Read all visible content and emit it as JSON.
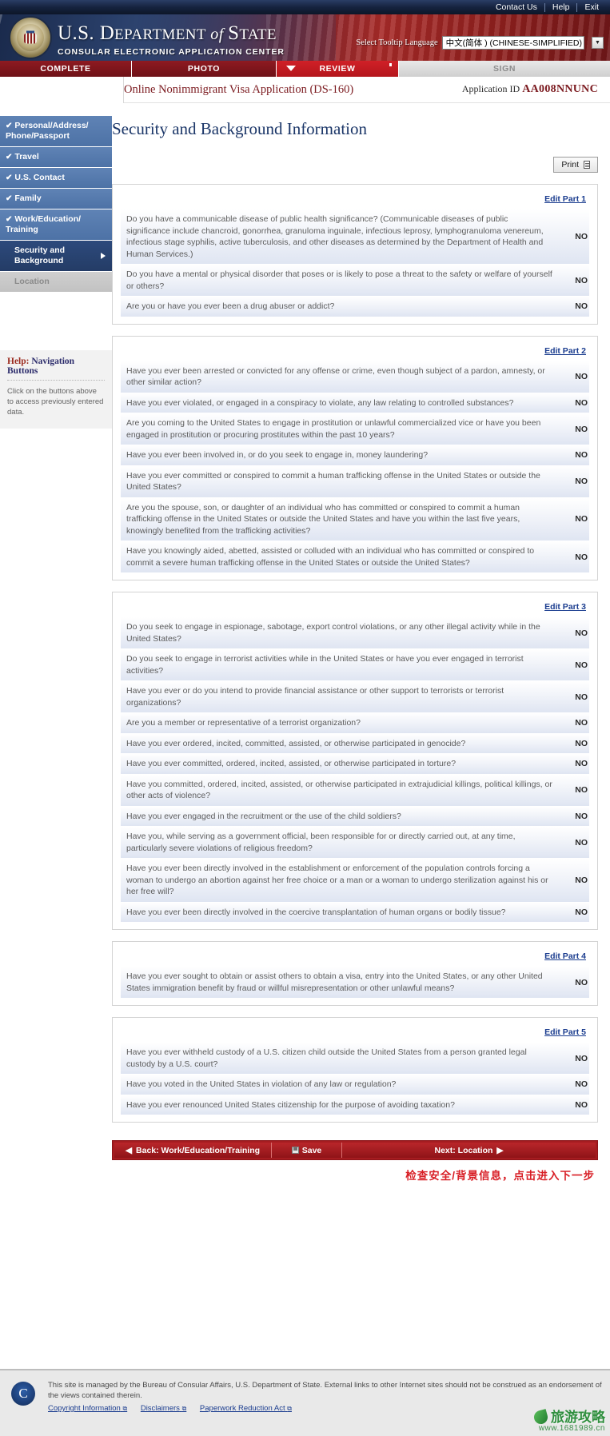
{
  "topbar": {
    "links": [
      "Contact Us",
      "Help",
      "Exit"
    ]
  },
  "banner": {
    "agency_line1_a": "U.S. D",
    "agency_line1_b": "EPARTMENT",
    "agency_line1_it": " of ",
    "agency_line1_c": "S",
    "agency_line1_d": "TATE",
    "agency_line2": "CONSULAR ELECTRONIC APPLICATION CENTER",
    "lang_label": "Select Tooltip Language",
    "lang_value": "中文(简体 ) (CHINESE-SIMPLIFIED)",
    "seal_icon": "us-great-seal-icon",
    "dropdown_icon": "chevron-down-icon"
  },
  "tabs": [
    {
      "label": "COMPLETE",
      "state": "done"
    },
    {
      "label": "PHOTO",
      "state": "done"
    },
    {
      "label": "REVIEW",
      "state": "active"
    },
    {
      "label": "SIGN",
      "state": "upcoming"
    }
  ],
  "apphead": {
    "form_title": "Online Nonimmigrant Visa Application (DS-160)",
    "appid_label": "Application ID",
    "appid_value": "AA008NNUNC"
  },
  "sidebar": {
    "items": [
      {
        "label": "Personal/Address/ Phone/Passport",
        "check": "✔",
        "state": "done"
      },
      {
        "label": "Travel",
        "check": "✔",
        "state": "done"
      },
      {
        "label": "U.S. Contact",
        "check": "✔",
        "state": "done"
      },
      {
        "label": "Family",
        "check": "✔",
        "state": "done"
      },
      {
        "label": "Work/Education/ Training",
        "check": "✔",
        "state": "done"
      },
      {
        "label": "Security and Background",
        "check": "",
        "state": "active"
      },
      {
        "label": "Location",
        "check": "",
        "state": "disabled"
      }
    ],
    "help": {
      "title_highlight": "Help:",
      "title_rest": " Navigation Buttons",
      "body": "Click on the buttons above to access previously entered data."
    }
  },
  "page": {
    "heading": "Security and Background Information",
    "print_label": "Print",
    "print_icon": "printer-icon"
  },
  "parts": [
    {
      "edit_label": "Edit Part 1",
      "questions": [
        {
          "text": "Do you have a communicable disease of public health significance? (Communicable diseases of public significance include chancroid, gonorrhea, granuloma inguinale, infectious leprosy, lymphogranuloma venereum, infectious stage syphilis, active tuberculosis, and other diseases as determined by the Department of Health and Human Services.)",
          "answer": "NO"
        },
        {
          "text": "Do you have a mental or physical disorder that poses or is likely to pose a threat to the safety or welfare of yourself or others?",
          "answer": "NO"
        },
        {
          "text": "Are you or have you ever been a drug abuser or addict?",
          "answer": "NO"
        }
      ]
    },
    {
      "edit_label": "Edit Part 2",
      "questions": [
        {
          "text": "Have you ever been arrested or convicted for any offense or crime, even though subject of a pardon, amnesty, or other similar action?",
          "answer": "NO"
        },
        {
          "text": "Have you ever violated, or engaged in a conspiracy to violate, any law relating to controlled substances?",
          "answer": "NO"
        },
        {
          "text": "Are you coming to the United States to engage in prostitution or unlawful commercialized vice or have you been engaged in prostitution or procuring prostitutes within the past 10 years?",
          "answer": "NO"
        },
        {
          "text": "Have you ever been involved in, or do you seek to engage in, money laundering?",
          "answer": "NO"
        },
        {
          "text": "Have you ever committed or conspired to commit a human trafficking offense in the United States or outside the United States?",
          "answer": "NO"
        },
        {
          "text": "Are you the spouse, son, or daughter of an individual who has committed or conspired to commit a human trafficking offense in the United States or outside the United States and have you within the last five years, knowingly benefited from the trafficking activities?",
          "answer": "NO"
        },
        {
          "text": "Have you knowingly aided, abetted, assisted or colluded with an individual who has committed or conspired to commit a severe human trafficking offense in the United States or outside the United States?",
          "answer": "NO"
        }
      ]
    },
    {
      "edit_label": "Edit Part 3",
      "questions": [
        {
          "text": "Do you seek to engage in espionage, sabotage, export control violations, or any other illegal activity while in the United States?",
          "answer": "NO"
        },
        {
          "text": "Do you seek to engage in terrorist activities while in the United States or have you ever engaged in terrorist activities?",
          "answer": "NO"
        },
        {
          "text": "Have you ever or do you intend to provide financial assistance or other support to terrorists or terrorist organizations?",
          "answer": "NO"
        },
        {
          "text": "Are you a member or representative of a terrorist organization?",
          "answer": "NO"
        },
        {
          "text": "Have you ever ordered, incited, committed, assisted, or otherwise participated in genocide?",
          "answer": "NO"
        },
        {
          "text": "Have you ever committed, ordered, incited, assisted, or otherwise participated in torture?",
          "answer": "NO"
        },
        {
          "text": "Have you committed, ordered, incited, assisted, or otherwise participated in extrajudicial killings, political killings, or other acts of violence?",
          "answer": "NO"
        },
        {
          "text": "Have you ever engaged in the recruitment or the use of the child soldiers?",
          "answer": "NO"
        },
        {
          "text": "Have you, while serving as a government official, been responsible for or directly carried out, at any time, particularly severe violations of religious freedom?",
          "answer": "NO"
        },
        {
          "text": "Have you ever been directly involved in the establishment or enforcement of the population controls forcing a woman to undergo an abortion against her free choice or a man or a woman to undergo sterilization against his or her free will?",
          "answer": "NO"
        },
        {
          "text": "Have you ever been directly involved in the coercive transplantation of human organs or bodily tissue?",
          "answer": "NO"
        }
      ]
    },
    {
      "edit_label": "Edit Part 4",
      "questions": [
        {
          "text": "Have you ever sought to obtain or assist others to obtain a visa, entry into the United States, or any other United States immigration benefit by fraud or willful misrepresentation or other unlawful means?",
          "answer": "NO"
        }
      ]
    },
    {
      "edit_label": "Edit Part 5",
      "questions": [
        {
          "text": "Have you ever withheld custody of a U.S. citizen child outside the United States from a person granted legal custody by a U.S. court?",
          "answer": "NO"
        },
        {
          "text": "Have you voted in the United States in violation of any law or regulation?",
          "answer": "NO"
        },
        {
          "text": "Have you ever renounced United States citizenship for the purpose of avoiding taxation?",
          "answer": "NO"
        }
      ]
    }
  ],
  "bottom_nav": {
    "back_label": "Back: Work/Education/Training",
    "save_label": "Save",
    "next_label": "Next: Location",
    "back_arrow": "◀",
    "next_arrow": "▶",
    "save_icon": "floppy-disk-icon"
  },
  "annotation": {
    "text": "检查安全/背景信息，点击进入下一步",
    "color": "#d81f26"
  },
  "footer": {
    "seal_icon": "consular-affairs-seal-icon",
    "text": "This site is managed by the Bureau of Consular Affairs, U.S. Department of State. External links to other Internet sites should not be construed as an endorsement of the views contained therein.",
    "links": [
      {
        "label": "Copyright Information",
        "icon": "external-link-icon"
      },
      {
        "label": "Disclaimers",
        "icon": "external-link-icon"
      },
      {
        "label": "Paperwork Reduction Act",
        "icon": "external-link-icon"
      }
    ]
  },
  "watermark": {
    "title": "旅游攻略",
    "url": "www.1681989.cn",
    "leaf_icon": "leaf-icon"
  }
}
